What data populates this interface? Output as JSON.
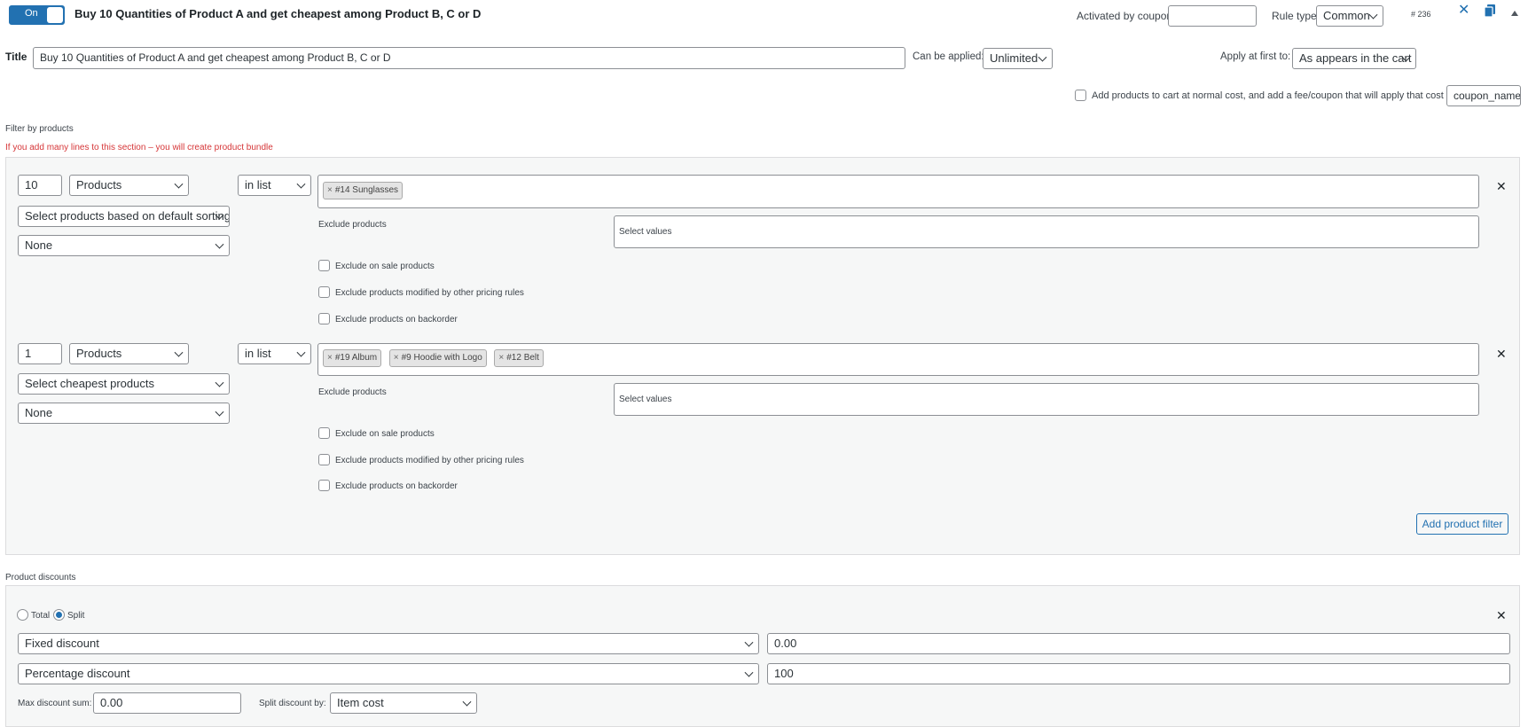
{
  "header": {
    "toggle_label": "On",
    "rule_title": "Buy 10 Quantities of Product A and get cheapest among Product B, C or D",
    "activated_by_coupon_label": "Activated by coupon",
    "activated_by_coupon_value": "",
    "rule_type_label": "Rule type",
    "rule_type_value": "Common",
    "rule_id": "# 236"
  },
  "title_row": {
    "title_label": "Title",
    "title_value": "Buy 10 Quantities of Product A and get cheapest among Product B, C or D",
    "can_be_applied_label": "Can be applied:",
    "can_be_applied_value": "Unlimited",
    "apply_at_first_label": "Apply at first to:",
    "apply_at_first_value": "As appears in the cart"
  },
  "fee_row": {
    "label": "Add products to cart at normal cost, and add a fee/coupon that will apply that cost",
    "coupon_value": "coupon_name"
  },
  "filter_section": {
    "heading": "Filter by products",
    "warning": "If you add many lines to this section – you will create product bundle",
    "filters": [
      {
        "qty": "10",
        "type": "Products",
        "sorting": "Select products based on default sorting",
        "extra": "None",
        "mode": "in list",
        "tags": [
          "#14 Sunglasses"
        ],
        "exclude_label": "Exclude products",
        "exclude_placeholder": "Select values",
        "checks": [
          "Exclude on sale products",
          "Exclude products modified by other pricing rules",
          "Exclude products on backorder"
        ]
      },
      {
        "qty": "1",
        "type": "Products",
        "sorting": "Select cheapest products",
        "extra": "None",
        "mode": "in list",
        "tags": [
          "#19 Album",
          "#9 Hoodie with Logo",
          "#12 Belt"
        ],
        "exclude_label": "Exclude products",
        "exclude_placeholder": "Select values",
        "checks": [
          "Exclude on sale products",
          "Exclude products modified by other pricing rules",
          "Exclude products on backorder"
        ]
      }
    ],
    "add_button": "Add product filter"
  },
  "discounts": {
    "heading": "Product discounts",
    "radio_total": "Total",
    "radio_split": "Split",
    "selected_radio": "Split",
    "rows": [
      {
        "type": "Fixed discount",
        "value": "0.00"
      },
      {
        "type": "Percentage discount",
        "value": "100"
      }
    ],
    "max_sum_label": "Max discount sum:",
    "max_sum_value": "0.00",
    "split_by_label": "Split discount by:",
    "split_by_value": "Item cost"
  },
  "colors": {
    "accent": "#2271b1",
    "warning": "#d63638",
    "panel_bg": "#f6f7f7"
  },
  "icons": {
    "close": "x-icon",
    "delete_rule": "x-icon",
    "clone_rule": "copy-icon",
    "collapse": "triangle-up-icon"
  }
}
